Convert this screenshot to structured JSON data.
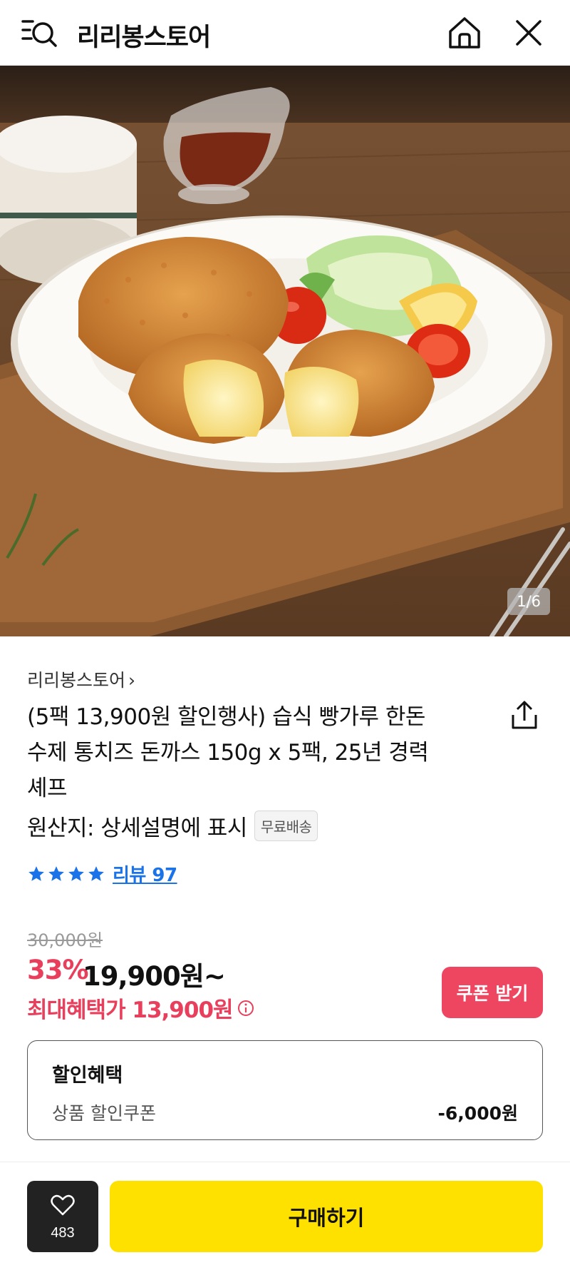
{
  "header": {
    "title": "리리봉스토어",
    "icons": [
      "search-menu-icon",
      "home-icon",
      "close-icon"
    ]
  },
  "hero": {
    "pager": "1/6"
  },
  "product": {
    "seller": "리리봉스토어",
    "seller_chevron": "›",
    "title": "(5팩 13,900원 할인행사) 습식 빵가루 한돈 수제 통치즈 돈까스 150g x 5팩, 25년 경력 셰프",
    "origin": "원산지: 상세설명에 표시",
    "shipping_badge": "무료배송",
    "rating_stars": 4,
    "review_label": "리뷰 97"
  },
  "price": {
    "original": "30,000원",
    "discount_pct": "33%",
    "sale": "19,900원~",
    "max_benefit": "최대혜택가 13,900원",
    "coupon_button": "쿠폰 받기"
  },
  "discount": {
    "title": "할인혜택",
    "label": "상품 할인쿠폰",
    "value": "-6,000원"
  },
  "bottom": {
    "like_count": "483",
    "buy_button": "구매하기"
  },
  "colors": {
    "accent_red": "#ee4560",
    "buy_yellow": "#ffe100",
    "star_blue": "#1a73e8"
  }
}
